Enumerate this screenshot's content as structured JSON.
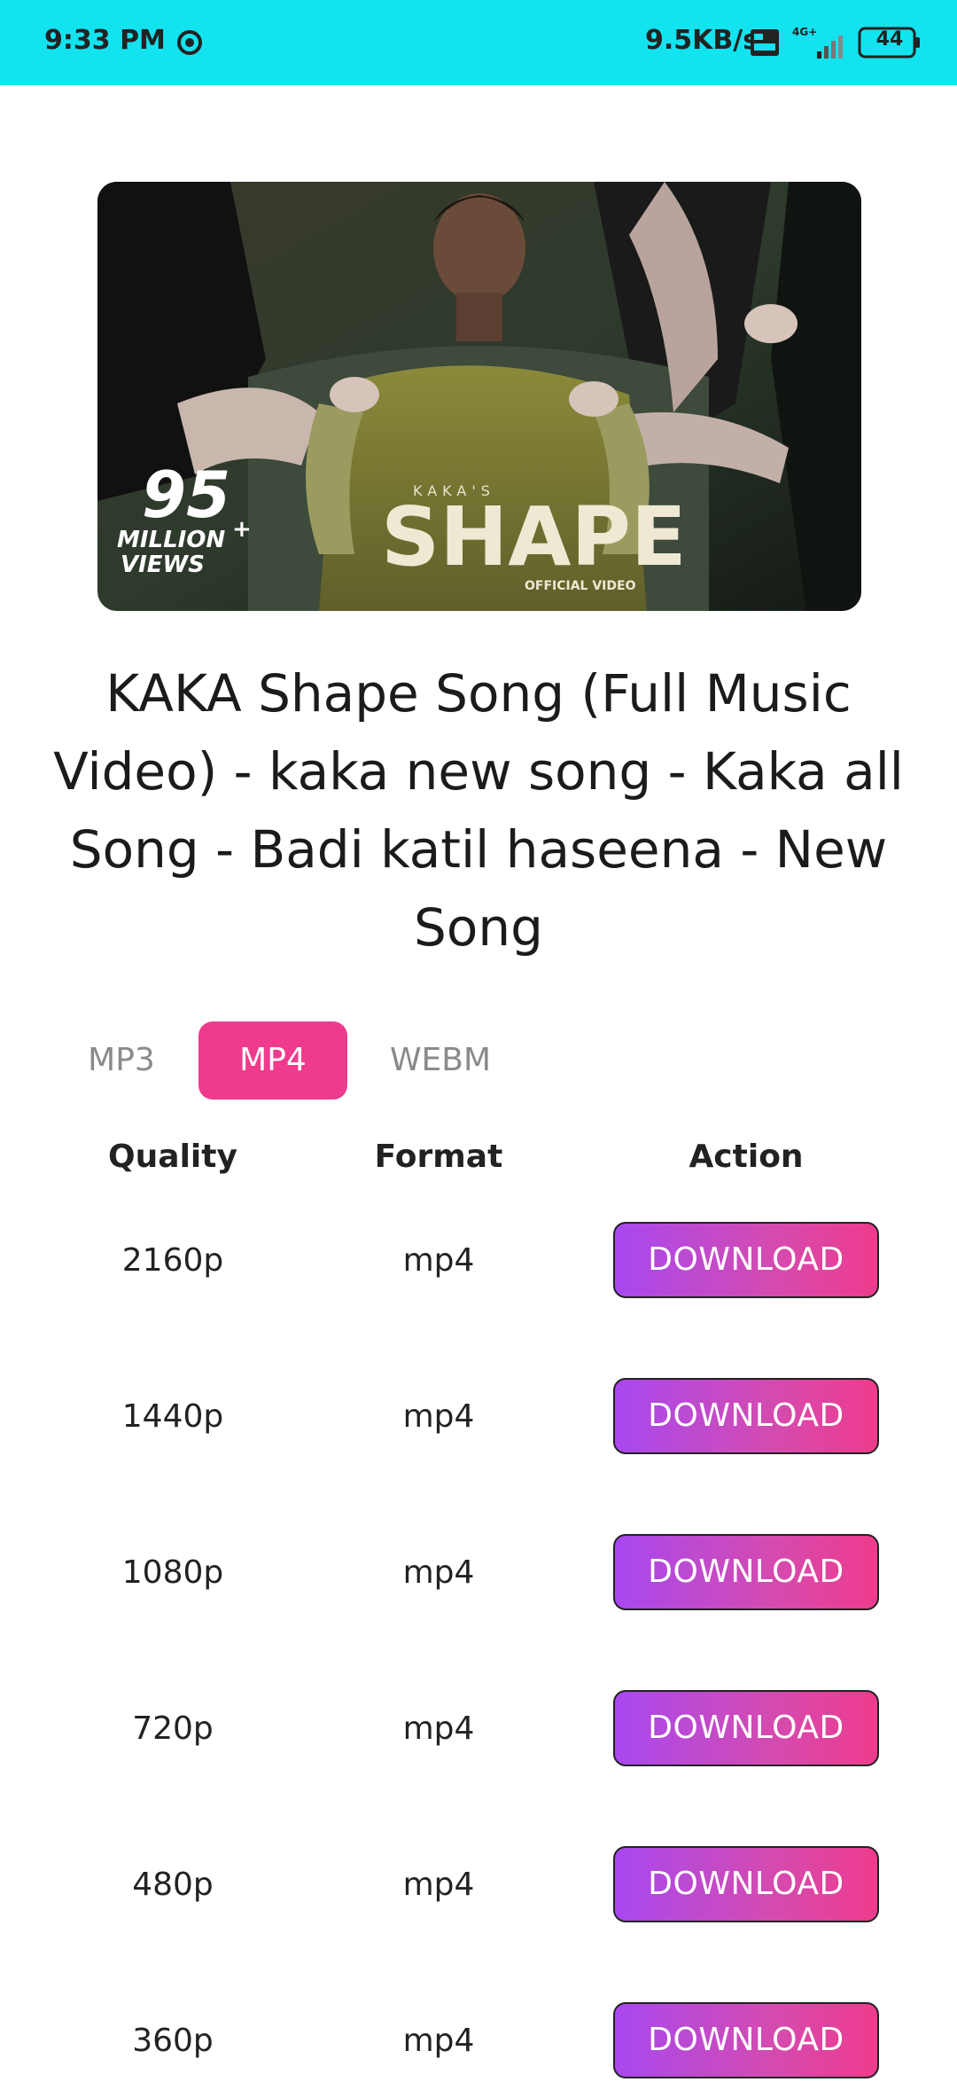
{
  "status_bar": {
    "time": "9:33 PM",
    "net_speed": "9.5KB/s",
    "net_type": "4G+",
    "battery": "44",
    "bg_color": "#13e3ef"
  },
  "video": {
    "thumbnail": {
      "views_number": "95",
      "views_million": "MILLION",
      "views_plus": "+",
      "views_label": "VIEWS",
      "artist": "KAKA'S",
      "song": "SHAPE",
      "tag": "OFFICIAL VIDEO"
    },
    "title": "KAKA Shape Song (Full Music Video) - kaka new song - Kaka all Song - Badi katil haseena - New Song"
  },
  "tabs": [
    {
      "label": "MP3",
      "active": false
    },
    {
      "label": "MP4",
      "active": true
    },
    {
      "label": "WEBM",
      "active": false
    }
  ],
  "table": {
    "headers": {
      "quality": "Quality",
      "format": "Format",
      "action": "Action"
    },
    "rows": [
      {
        "quality": "2160p",
        "format": "mp4",
        "action": "DOWNLOAD"
      },
      {
        "quality": "1440p",
        "format": "mp4",
        "action": "DOWNLOAD"
      },
      {
        "quality": "1080p",
        "format": "mp4",
        "action": "DOWNLOAD"
      },
      {
        "quality": "720p",
        "format": "mp4",
        "action": "DOWNLOAD"
      },
      {
        "quality": "480p",
        "format": "mp4",
        "action": "DOWNLOAD"
      },
      {
        "quality": "360p",
        "format": "mp4",
        "action": "DOWNLOAD"
      }
    ]
  },
  "colors": {
    "accent": "#ee3b8d",
    "button_gradient_start": "#a848f0",
    "button_gradient_end": "#ee3b8d"
  }
}
